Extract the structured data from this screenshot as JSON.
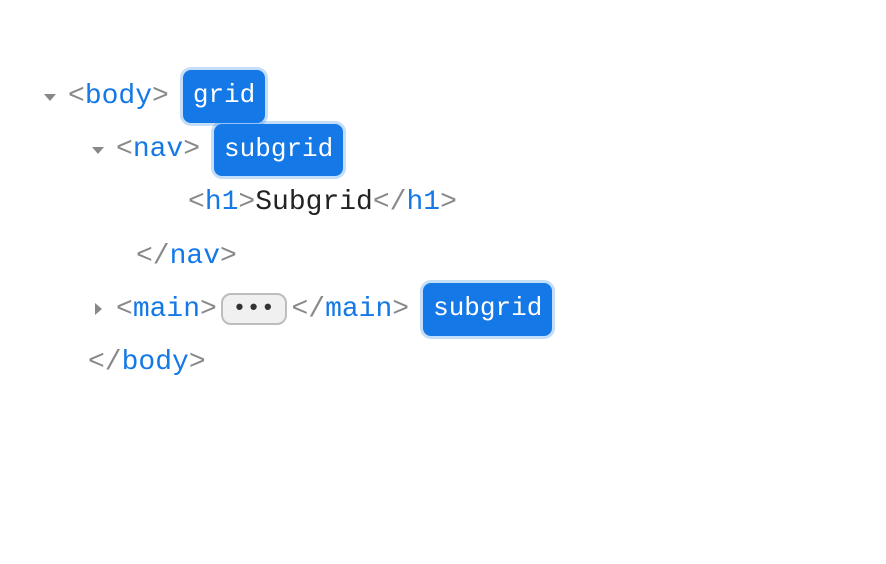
{
  "rows": [
    {
      "tag": "body",
      "badge": "grid"
    },
    {
      "tag": "nav",
      "badge": "subgrid"
    },
    {
      "tag": "h1",
      "text": "Subgrid"
    },
    {
      "tag": "nav"
    },
    {
      "tag": "main",
      "badge": "subgrid",
      "ellipsis": "•••"
    },
    {
      "tag": "body"
    }
  ],
  "chars": {
    "lt": "<",
    "gt": ">",
    "lts": "</"
  }
}
